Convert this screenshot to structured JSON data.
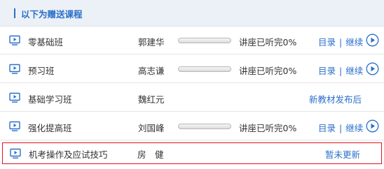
{
  "header": {
    "title": "以下为赠送课程"
  },
  "colors": {
    "accent": "#2a6fc9",
    "highlight_border": "#e1141b",
    "header_bg": "#ecf1f7"
  },
  "courses": [
    {
      "name": "零基础班",
      "teacher": "郭建华",
      "progress": 0,
      "progress_text": "讲座已听完0%",
      "list_label": "目录",
      "continue_label": "继续",
      "icon": "screen-icon"
    },
    {
      "name": "预习班",
      "teacher": "高志谦",
      "progress": 0,
      "progress_text": "讲座已听完0%",
      "list_label": "目录",
      "continue_label": "继续",
      "icon": "screen-icon"
    },
    {
      "name": "基础学习班",
      "teacher": "魏红元",
      "status": "新教材发布后",
      "icon": "screen-icon"
    },
    {
      "name": "强化提高班",
      "teacher": "刘国峰",
      "progress": 0,
      "progress_text": "讲座已听完0%",
      "list_label": "目录",
      "continue_label": "继续",
      "icon": "screen-icon"
    },
    {
      "name": "机考操作及应试技巧",
      "teacher": "房　健",
      "status": "暂未更新",
      "icon": "screen-icon"
    }
  ]
}
